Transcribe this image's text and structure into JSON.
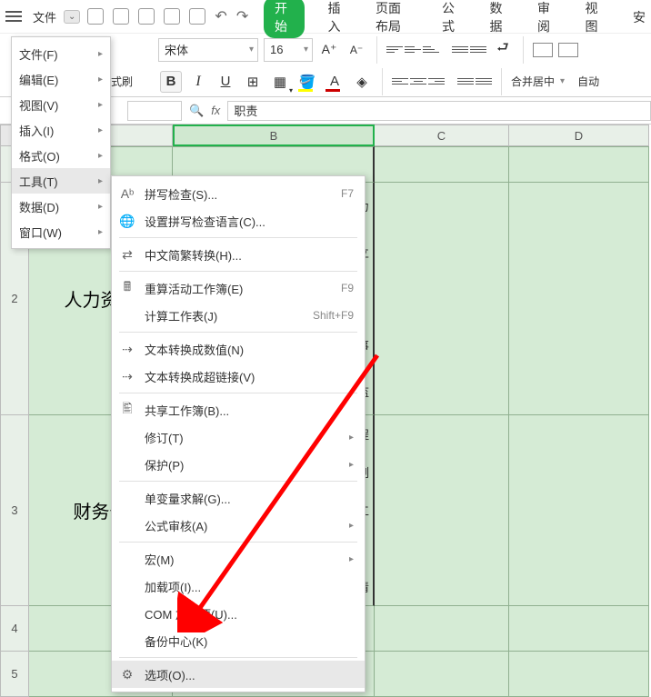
{
  "file": {
    "label": "文件"
  },
  "tabs": {
    "start": "开始",
    "insert": "插入",
    "pagelayout": "页面布局",
    "formula": "公式",
    "data": "数据",
    "review": "审阅",
    "view": "视图",
    "safe": "安"
  },
  "toolbar": {
    "painter": "式刷",
    "font": "宋体",
    "size": "16",
    "merge": "合并居中",
    "auto": "自动"
  },
  "formula_bar": {
    "fx": "fx",
    "value": "职责"
  },
  "menu1": {
    "file": "文件(F)",
    "edit": "编辑(E)",
    "view": "视图(V)",
    "insert": "插入(I)",
    "format": "格式(O)",
    "tools": "工具(T)",
    "data": "数据(D)",
    "window": "窗口(W)"
  },
  "menu2": {
    "spell": "拼写检查(S)...",
    "spell_sc": "F7",
    "spell_lang": "设置拼写检查语言(C)...",
    "ts": "中文简繁转换(H)...",
    "recalc": "重算活动工作簿(E)",
    "recalc_sc": "F9",
    "calc_sheet": "计算工作表(J)",
    "calc_sc": "Shift+F9",
    "to_num": "文本转换成数值(N)",
    "to_link": "文本转换成超链接(V)",
    "share": "共享工作簿(B)...",
    "revise": "修订(T)",
    "protect": "保护(P)",
    "solver": "单变量求解(G)...",
    "audit": "公式审核(A)",
    "macro": "宏(M)",
    "addin": "加载项(I)...",
    "com": "COM 加载项(U)...",
    "backup": "备份中心(K)",
    "options": "选项(O)..."
  },
  "cells": {
    "a2": "人力资源",
    "a3": "财务部",
    "b2a": "力",
    "b2b": "立",
    "b2c": "；",
    "b2d": "事",
    "b2e": "监",
    "b3a": "程",
    "b3b": "制",
    "b3c": "工",
    "b3d": "，",
    "b3e": "清"
  },
  "cols": {
    "b": "B",
    "c": "C",
    "d": "D"
  },
  "rows": {
    "r2": "2",
    "r3": "3",
    "r4": "4",
    "r5": "5"
  }
}
